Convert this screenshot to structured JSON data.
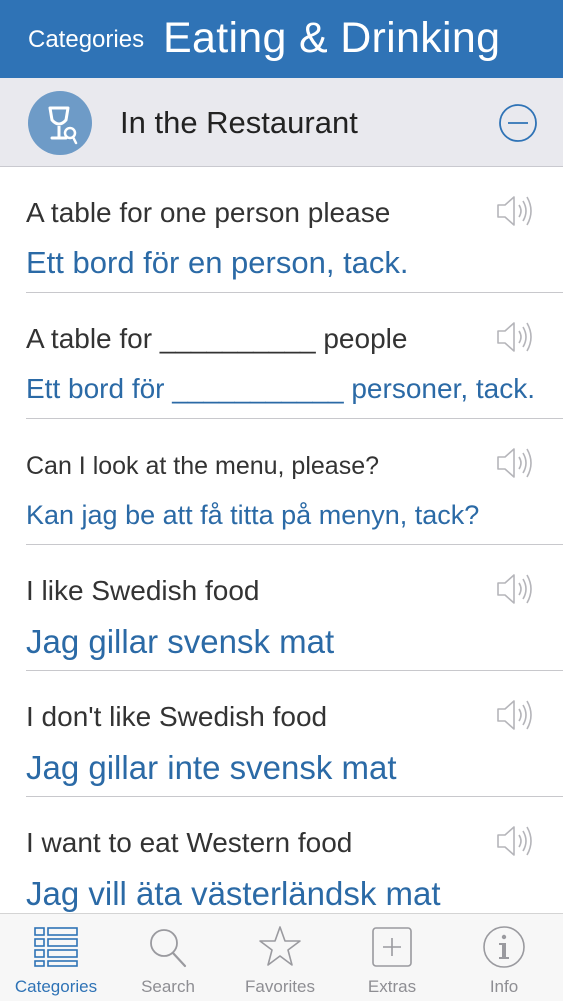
{
  "navbar": {
    "back_label": "Categories",
    "title": "Eating & Drinking"
  },
  "section": {
    "title": "In the Restaurant",
    "badge_icon": "wine-glass-fork-icon",
    "collapse_icon": "minus-circle-icon"
  },
  "phrases": [
    {
      "source": "A table for one person please",
      "translation": "Ett bord för en person, tack."
    },
    {
      "source": "A table for __________ people",
      "translation": "Ett bord för ___________ personer, tack."
    },
    {
      "source": "Can I look at the menu, please?",
      "translation": "Kan jag be att få titta på menyn, tack?"
    },
    {
      "source": "I like Swedish food",
      "translation": "Jag gillar svensk mat"
    },
    {
      "source": "I don't like Swedish food",
      "translation": "Jag gillar inte svensk mat"
    },
    {
      "source": "I want to eat Western food",
      "translation": "Jag vill äta västerländsk mat"
    }
  ],
  "tabbar": {
    "items": [
      {
        "label": "Categories",
        "icon": "list-icon",
        "active": true
      },
      {
        "label": "Search",
        "icon": "search-icon",
        "active": false
      },
      {
        "label": "Favorites",
        "icon": "star-icon",
        "active": false
      },
      {
        "label": "Extras",
        "icon": "plus-box-icon",
        "active": false
      },
      {
        "label": "Info",
        "icon": "info-icon",
        "active": false
      }
    ]
  },
  "colors": {
    "accent": "#2f73b6",
    "translation_text": "#2b6aa6",
    "section_bg": "#e9e9ee",
    "inactive_tab": "#8e8e93"
  }
}
